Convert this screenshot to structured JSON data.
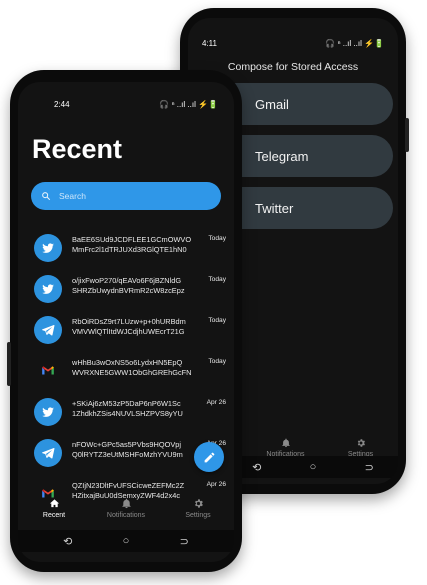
{
  "back": {
    "status_time": "4:11",
    "status_icons": "🎧 ⁿ ..ıl ..ıl ⚡🔋",
    "title": "Compose for Stored Access",
    "services": [
      "Gmail",
      "Telegram",
      "Twitter"
    ],
    "nav": {
      "notifications": "Notifications",
      "settings": "Settings"
    }
  },
  "front": {
    "status_time": "2:44",
    "status_icons": "🎧 ⁿ ..ıl ..ıl ⚡🔋",
    "page_title": "Recent",
    "search_placeholder": "Search",
    "messages": [
      {
        "app": "twitter",
        "line1": "BaEE6SUd9JCDFLEE1GCmOWVO",
        "line2": "MmFrc2l1dTRJUXd3RGlQTE1hN0",
        "date": "Today"
      },
      {
        "app": "twitter",
        "line1": "o/jixFwoP270/qEAVo6F6jBZNldG",
        "line2": "SHRZbUwydnBVRmR2cW8zcEpz",
        "date": "Today"
      },
      {
        "app": "telegram",
        "line1": "RbOiRDsZ9rt7LUzw+p+0hURBdm",
        "line2": "VMVWlQTlItdWJCdjhUWEcrT21G",
        "date": "Today"
      },
      {
        "app": "gmail",
        "line1": "wHhBu3wOxNS5o6LydxHN5EpQ",
        "line2": "WVRXNE5GWW1ObGhGREhGcFN",
        "date": "Today"
      },
      {
        "app": "twitter",
        "line1": "+SKiAj6zM53zP5DaP6nP6W1Sc",
        "line2": "1ZhdkhZSis4NUVLSHZPVS8yYU",
        "date": "Apr 26"
      },
      {
        "app": "telegram",
        "line1": "nFOWc+GPc5as5PVbs9HQOVpj",
        "line2": "Q0lRYTZ3eUtMSHFoMzhYVU9m",
        "date": "Apr 26"
      },
      {
        "app": "gmail",
        "line1": "QZIjN23DltFvUFSCicweZEFMc2Z",
        "line2": "HZitxajBuU0dSemxyZWF4d2x4c",
        "date": "Apr 26"
      }
    ],
    "nav": {
      "recent": "Recent",
      "notifications": "Notifications",
      "settings": "Settings"
    }
  },
  "colors": {
    "accent": "#2f97e8",
    "background": "#131313",
    "button": "#313a40"
  },
  "icons": [
    "search-icon",
    "twitter-icon",
    "telegram-icon",
    "gmail-icon",
    "edit-icon",
    "home-icon",
    "bell-icon",
    "gear-icon"
  ]
}
